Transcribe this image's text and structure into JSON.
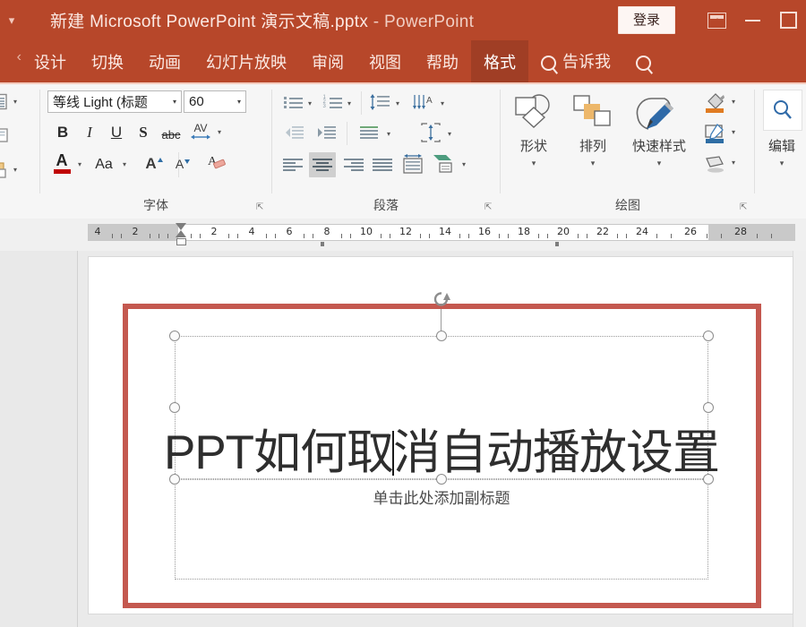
{
  "titlebar": {
    "qat_icon": "qat-dropdown-icon",
    "document_name": "新建 Microsoft PowerPoint 演示文稿.pptx",
    "separator": "-",
    "app_name": "PowerPoint",
    "signin_label": "登录",
    "ribbon_display_icon": "ribbon-display-options-icon",
    "minimize_icon": "minimize-icon",
    "maximize_icon": "maximize-icon",
    "background_color": "#b7472a"
  },
  "tabs": {
    "overflow_icon": "tab-overflow-icon",
    "items": [
      {
        "label": "设计",
        "active": false
      },
      {
        "label": "切换",
        "active": false
      },
      {
        "label": "动画",
        "active": false
      },
      {
        "label": "幻灯片放映",
        "active": false
      },
      {
        "label": "审阅",
        "active": false
      },
      {
        "label": "视图",
        "active": false
      },
      {
        "label": "帮助",
        "active": false
      },
      {
        "label": "格式",
        "active": true
      }
    ],
    "tell_me": {
      "label": "告诉我",
      "icon": "search-icon"
    },
    "account_icon": "account-search-icon",
    "active_tab_color": "#a03e25"
  },
  "ribbon": {
    "slides_group": {
      "new_slide_icon": "new-slide-icon",
      "layout_icon": "layout-icon",
      "reset_icon": "reset-icon",
      "section_icon": "section-icon"
    },
    "font_group": {
      "label": "字体",
      "font_name_value": "等线 Light (标题",
      "font_size_value": "60",
      "bold_label": "B",
      "italic_label": "I",
      "underline_label": "U",
      "shadow_label": "S",
      "strikethrough_label": "abc",
      "char_spacing_label": "AV",
      "font_color_label": "A",
      "change_case_label": "Aa",
      "grow_font_label": "A",
      "shrink_font_label": "A",
      "clear_format_label": "A",
      "font_color_swatch": "#c00000",
      "dialog_launcher_icon": "dialog-launcher-icon"
    },
    "paragraph_group": {
      "label": "段落",
      "bullets_icon": "bullets-icon",
      "numbering_icon": "numbering-icon",
      "line_spacing_icon": "line-spacing-icon",
      "text_direction_icon": "text-direction-icon",
      "decrease_indent_icon": "decrease-indent-icon",
      "increase_indent_icon": "increase-indent-icon",
      "align_text_icon": "align-text-icon",
      "text_box_icon": "text-box-align-icon",
      "align_left_icon": "align-left-icon",
      "align_center_icon": "align-center-icon",
      "align_right_icon": "align-right-icon",
      "justify_icon": "justify-icon",
      "columns_icon": "columns-icon",
      "smartart_icon": "convert-to-smartart-icon",
      "dialog_launcher_icon": "dialog-launcher-icon"
    },
    "drawing_group": {
      "label": "绘图",
      "shapes_label": "形状",
      "arrange_label": "排列",
      "quick_styles_label": "快速样式",
      "shape_fill_icon": "shape-fill-icon",
      "shape_outline_icon": "shape-outline-icon",
      "shape_effects_icon": "shape-effects-icon",
      "dialog_launcher_icon": "dialog-launcher-icon"
    },
    "editing_group": {
      "label": "编辑",
      "icon": "find-magnifier-icon"
    }
  },
  "ruler": {
    "labels": [
      "4",
      "2",
      "2",
      "4",
      "6",
      "8",
      "10",
      "12",
      "14",
      "16",
      "18",
      "20",
      "22",
      "24",
      "26",
      "28"
    ],
    "indent_marker_icon": "indent-marker-icon"
  },
  "slide": {
    "shape": {
      "name": "rectangle-shape",
      "border_color": "#c4584f"
    },
    "title_placeholder": {
      "text_before_caret": "PPT如何取",
      "text_after_caret": "消自动播放设置",
      "full_text": "PPT如何取消自动播放设置"
    },
    "subtitle_placeholder": {
      "text": "单击此处添加副标题"
    },
    "rotation_handle_icon": "rotation-handle-icon",
    "watermark": ""
  }
}
